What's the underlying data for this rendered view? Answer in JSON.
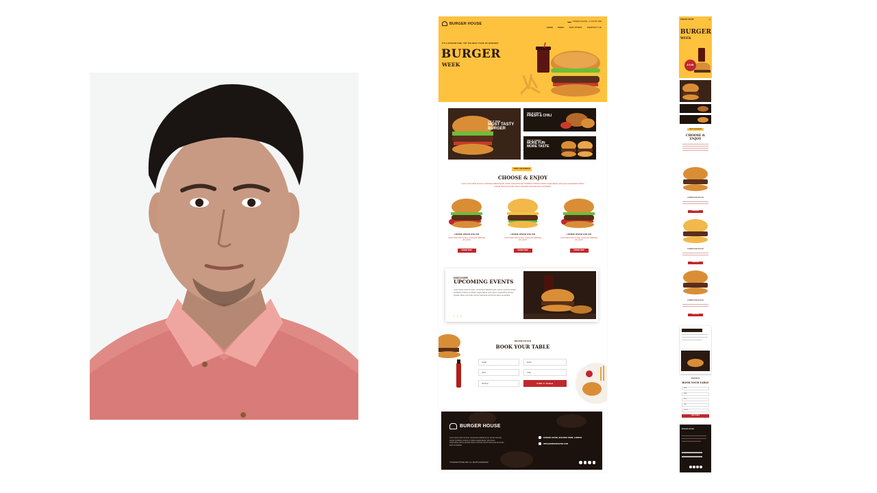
{
  "colors": {
    "brand_yellow": "#ffc23e",
    "brand_red": "#c0282d",
    "dark": "#1c120d",
    "text_dark": "#2a1a10"
  },
  "desktop": {
    "logo": "BURGER HOUSE",
    "contact": "ORDER ONLINE: +1 234 567 890",
    "nav": [
      "HOME",
      "MENU",
      "OUR STORY",
      "CONTACT US"
    ],
    "hero": {
      "tagline": "IT'S A BURGER FINE, TRY THE BEST TASTE OF BURGERS",
      "title": "BURGER",
      "subtitle": "WEEK"
    },
    "promos": [
      {
        "kicker": "TRY IT NOW",
        "title_line1": "MOST TASTY",
        "title_line2": "BURGER"
      },
      {
        "kicker": "TRY IT TODAY",
        "title_line1": "FRESH & CHILI",
        "title_line2": ""
      },
      {
        "kicker": "TRY IT TODAY",
        "title_line1": "MORE FUN",
        "title_line2": "MORE TASTE"
      }
    ],
    "menu_section": {
      "tag": "TASTE THE BURGER",
      "title": "CHOOSE & ENJOY",
      "description": "Lorem ipsum dolor sit amet, consectetur adipiscing elit, sed do eiusmod tempor incididunt ut labore et dolore magna aliqua. Quis ipsum suspendisse ultrices gravida. Risus commodo viverra maecenas accumsan lacus vel facilisis.",
      "items": [
        {
          "title": "LOREM IPSUM DOLOR",
          "desc": "Lorem ipsum dolor sit amet, consectetur adipiscing elit, sed do",
          "button": "ORDER NOW"
        },
        {
          "title": "LOREM IPSUM DOLOR",
          "desc": "Lorem ipsum dolor sit amet, consectetur adipiscing elit, sed do",
          "button": "ORDER NOW"
        },
        {
          "title": "LOREM IPSUM DOLOR",
          "desc": "Lorem ipsum dolor sit amet, consectetur adipiscing elit, sed do",
          "button": "ORDER NOW"
        }
      ]
    },
    "events": {
      "kicker": "DISCOVER",
      "title": "UPCOMING EVENTS",
      "description": "Lorem ipsum dolor sit amet, consectetur adipiscing elit, sed do eiusmod tempor incididunt ut labore et dolore magna aliqua. Quis ipsum suspendisse ultrices gravida. Risus commodo viverra maecenas accumsan lacus vel facilisis.",
      "dots": "● ● ●"
    },
    "booking": {
      "kicker": "RESERVATION",
      "title": "BOOK YOUR TABLE",
      "fields": [
        "NAME",
        "EMAIL",
        "DATE",
        "TIME",
        "PEOPLE"
      ],
      "button": "FIND A TABLE"
    },
    "footer": {
      "logo": "BURGER HOUSE",
      "description": "Lorem ipsum dolor sit amet, consectetur adipiscing elit, sed do eiusmod tempor incididunt ut labore et dolore magna aliqua. Quis ipsum suspendisse ultrices gravida. Risus commodo viverra maecenas accumsan lacus vel facilisis.",
      "address": "BURGER HOUSE, BUILDING NAME, LONDON",
      "email": "INFO@BURGERHOUSE.COM",
      "copyright": "© BURGER HOUSE 2022. ALL RIGHTS RESERVED"
    }
  },
  "mobile": {
    "logo": "BURGER HOUSE",
    "menu_icon": "≡",
    "hero_title": "BURGER",
    "hero_sub": "WEEK",
    "price": "$ 5.99",
    "tag": "TASTE THE BURGER",
    "section_title_1": "CHOOSE &",
    "section_title_2": "ENJOY",
    "item_title": "LOREM IPSUM DOLOR",
    "item_button": "ORDER NOW",
    "booking_kicker": "RESERVATION",
    "booking_title": "BOOK YOUR TABLE",
    "fields": [
      "NAME",
      "EMAIL",
      "DATE",
      "TIME",
      "PEOPLE"
    ],
    "booking_button": "FIND A TABLE",
    "footer_logo": "BURGER HOUSE"
  }
}
